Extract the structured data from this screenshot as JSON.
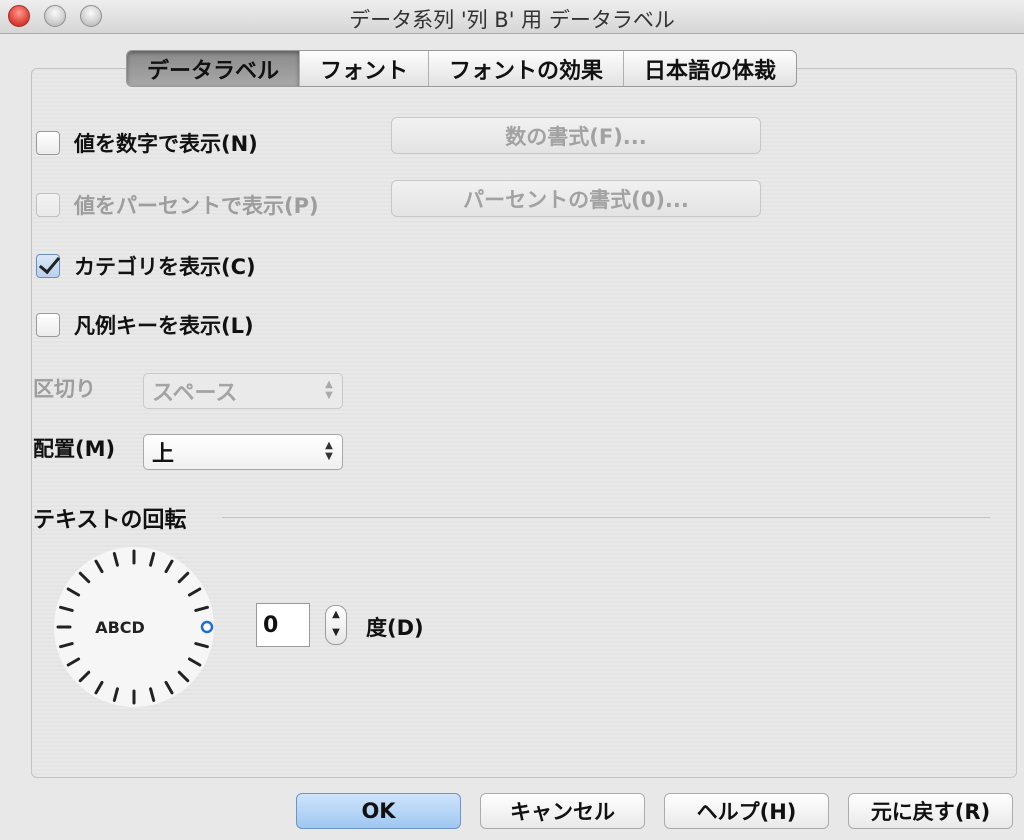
{
  "window": {
    "title": "データ系列 '列 B' 用 データラベル"
  },
  "tabs": [
    {
      "label": "データラベル"
    },
    {
      "label": "フォント"
    },
    {
      "label": "フォントの効果"
    },
    {
      "label": "日本語の体裁"
    }
  ],
  "options": {
    "show_value_number": {
      "label": "値を数字で表示(N)",
      "checked": false,
      "enabled": true
    },
    "show_value_percent": {
      "label": "値をパーセントで表示(P)",
      "checked": false,
      "enabled": false
    },
    "show_category": {
      "label": "カテゴリを表示(C)",
      "checked": true,
      "enabled": true
    },
    "show_legend_key": {
      "label": "凡例キーを表示(L)",
      "checked": false,
      "enabled": true
    }
  },
  "buttons": {
    "number_format": "数の書式(F)...",
    "percent_format": "パーセントの書式(0)...",
    "ok": "OK",
    "cancel": "キャンセル",
    "help": "ヘルプ(H)",
    "reset": "元に戻す(R)"
  },
  "separator": {
    "label": "区切り",
    "value": "スペース",
    "enabled": false
  },
  "placement": {
    "label": "配置(M)",
    "value": "上"
  },
  "rotation": {
    "section_title": "テキストの回転",
    "dial_text": "ABCD",
    "degrees_value": "0",
    "degrees_label": "度(D)"
  },
  "icons": {
    "stepper_up": "▲",
    "stepper_down": "▼"
  }
}
